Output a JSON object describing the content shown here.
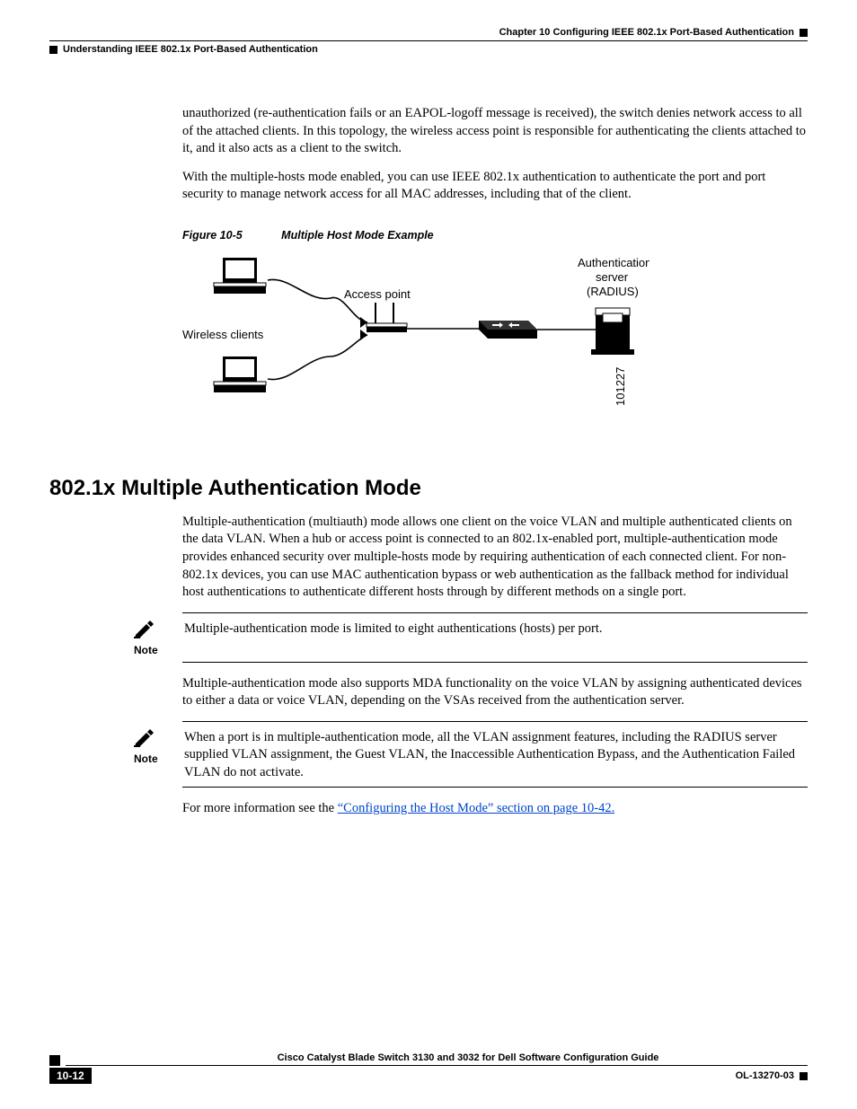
{
  "header": {
    "chapter": "Chapter 10    Configuring IEEE 802.1x Port-Based Authentication",
    "section": "Understanding IEEE 802.1x Port-Based Authentication"
  },
  "intro": {
    "p1": "unauthorized (re-authentication fails or an EAPOL-logoff message is received), the switch denies network access to all of the attached clients. In this topology, the wireless access point is responsible for authenticating the clients attached to it, and it also acts as a client to the switch.",
    "p2": "With the multiple-hosts mode enabled, you can use IEEE 802.1x authentication to authenticate the port and port security to manage network access for all MAC addresses, including that of the client."
  },
  "figure": {
    "id": "Figure 10-5",
    "title": "Multiple Host Mode Example",
    "labels": {
      "wireless": "Wireless clients",
      "ap": "Access point",
      "auth1": "Authentication",
      "auth2": "server",
      "auth3": "(RADIUS)",
      "imgid": "101227"
    }
  },
  "heading": "802.1x Multiple Authentication Mode",
  "main": {
    "p1": "Multiple-authentication (multiauth) mode allows one client on the voice VLAN and multiple authenticated clients on the data VLAN. When a hub or access point is connected to an 802.1x-enabled port, multiple-authentication mode provides enhanced security over multiple-hosts mode by requiring authentication of each connected client. For non-802.1x devices, you can use MAC authentication bypass or web authentication as the fallback method for individual host authentications to authenticate different hosts through by different methods on a single port.",
    "p2": "Multiple-authentication mode also supports MDA functionality on the voice VLAN by assigning authenticated devices to either a data or voice VLAN, depending on the VSAs received from the authentication server.",
    "p3_prefix": "For more information see the ",
    "p3_link": "“Configuring the Host Mode” section on page 10-42.",
    "p3_suffix": ""
  },
  "notes": {
    "label": "Note",
    "n1": "Multiple-authentication mode is limited to eight authentications (hosts) per port.",
    "n2": "When a port is in multiple-authentication mode, all the VLAN assignment features, including the RADIUS server supplied VLAN assignment, the Guest VLAN, the Inaccessible Authentication Bypass, and the Authentication Failed VLAN do not activate."
  },
  "footer": {
    "title": "Cisco Catalyst Blade Switch 3130 and 3032 for Dell Software Configuration Guide",
    "page": "10-12",
    "docid": "OL-13270-03"
  }
}
